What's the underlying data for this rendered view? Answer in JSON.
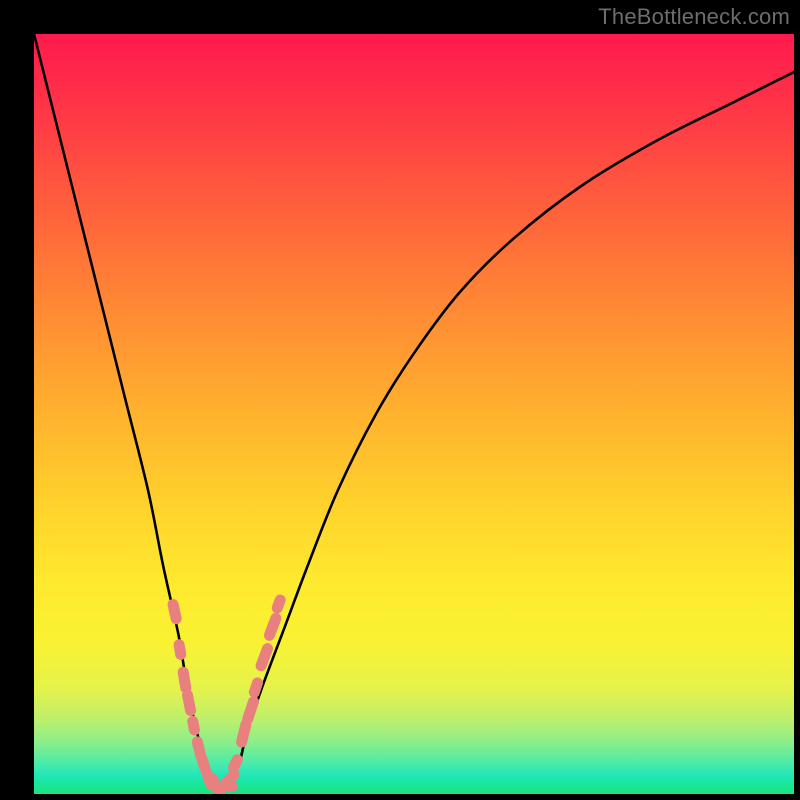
{
  "attribution": "TheBottleneck.com",
  "colors": {
    "background": "#000000",
    "attribution_text": "#6d6d6d",
    "curve_stroke": "#000000",
    "marker_fill": "#e98080",
    "gradient_stops": [
      "#ff1a4d",
      "#ff2a4a",
      "#ff4343",
      "#ff6a3a",
      "#ff8f33",
      "#ffb22e",
      "#ffd22c",
      "#ffe92e",
      "#f9f233",
      "#e6f24a",
      "#bff06a",
      "#8fee88",
      "#55eca4",
      "#22e7b9",
      "#19e7a0",
      "#1ee47a"
    ]
  },
  "chart_data": {
    "type": "line",
    "title": "",
    "xlabel": "",
    "ylabel": "",
    "xlim": [
      0,
      100
    ],
    "ylim": [
      0,
      100
    ],
    "notes": "V-shaped bottleneck curve; y-axis inverted visually (0 at bottom = best/green, 100 at top = worst/red). Minimum near x≈24 where curve touches baseline.",
    "series": [
      {
        "name": "bottleneck-curve",
        "x": [
          0,
          3,
          6,
          9,
          12,
          15,
          17,
          19,
          20,
          21,
          22,
          23,
          24,
          25,
          26,
          27,
          28,
          30,
          33,
          36,
          40,
          45,
          50,
          56,
          63,
          72,
          82,
          92,
          100
        ],
        "y": [
          100,
          88,
          76,
          64,
          52,
          40,
          30,
          21,
          15,
          10,
          6,
          3,
          1,
          1,
          2,
          4,
          8,
          14,
          22,
          30,
          40,
          50,
          58,
          66,
          73,
          80,
          86,
          91,
          95
        ]
      }
    ],
    "markers": {
      "name": "highlighted-points",
      "description": "Salmon rounded markers clustered near curve minimum on both branches.",
      "points": [
        {
          "x": 18.5,
          "y": 24,
          "size": 1.3
        },
        {
          "x": 19.2,
          "y": 19,
          "size": 0.9
        },
        {
          "x": 19.8,
          "y": 15,
          "size": 1.4
        },
        {
          "x": 20.4,
          "y": 12,
          "size": 1.4
        },
        {
          "x": 21.0,
          "y": 9,
          "size": 0.8
        },
        {
          "x": 21.7,
          "y": 6,
          "size": 1.2
        },
        {
          "x": 22.3,
          "y": 4,
          "size": 0.9
        },
        {
          "x": 23.0,
          "y": 2,
          "size": 1.0
        },
        {
          "x": 24.0,
          "y": 1,
          "size": 1.5
        },
        {
          "x": 25.0,
          "y": 1,
          "size": 1.5
        },
        {
          "x": 25.8,
          "y": 2,
          "size": 1.0
        },
        {
          "x": 26.5,
          "y": 4,
          "size": 0.8
        },
        {
          "x": 27.6,
          "y": 8,
          "size": 1.6
        },
        {
          "x": 28.5,
          "y": 11,
          "size": 1.6
        },
        {
          "x": 29.2,
          "y": 14,
          "size": 0.9
        },
        {
          "x": 30.3,
          "y": 18,
          "size": 1.6
        },
        {
          "x": 31.4,
          "y": 22,
          "size": 1.6
        },
        {
          "x": 32.2,
          "y": 25,
          "size": 0.8
        }
      ]
    }
  }
}
